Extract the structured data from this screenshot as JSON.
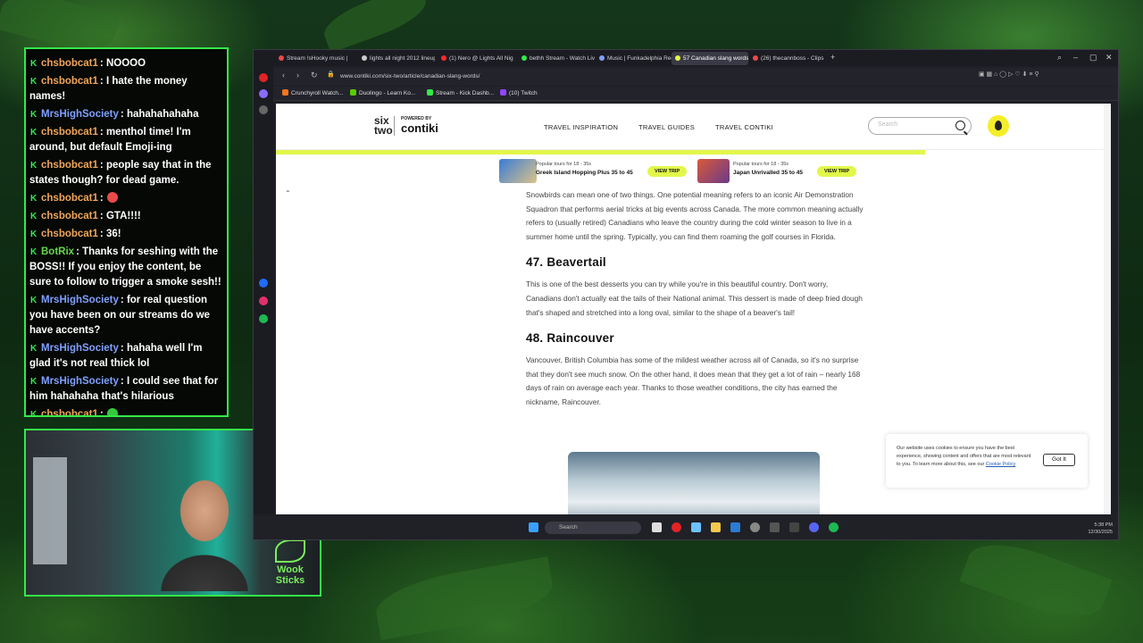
{
  "chat": {
    "messages": [
      {
        "user": "chsbobcat1",
        "text": ": NOOOO",
        "color": "#f0a55a"
      },
      {
        "user": "chsbobcat1",
        "text": ": I hate the money names!",
        "color": "#f0a55a"
      },
      {
        "user": "MrsHighSociety",
        "text": ": hahahahahaha",
        "color": "#7fa0ff"
      },
      {
        "user": "chsbobcat1",
        "text": ": menthol time! I'm around, but default Emoji-ing",
        "color": "#f0a55a"
      },
      {
        "user": "chsbobcat1",
        "text": ": people say that in the states though? for dead game.",
        "color": "#f0a55a"
      },
      {
        "user": "chsbobcat1",
        "text": ":",
        "color": "#f0a55a",
        "emoji": "#e94a4a"
      },
      {
        "user": "chsbobcat1",
        "text": ": GTA!!!!",
        "color": "#f0a55a"
      },
      {
        "user": "chsbobcat1",
        "text": ": 36!",
        "color": "#f0a55a"
      },
      {
        "user": "BotRix",
        "text": ": Thanks for seshing with the BOSS!! If you enjoy the content, be sure to follow to trigger a smoke sesh!!",
        "color": "#66d44a"
      },
      {
        "user": "MrsHighSociety",
        "text": ": for real question you have been on our streams do we have accents?",
        "color": "#7fa0ff"
      },
      {
        "user": "MrsHighSociety",
        "text": ": hahaha well I'm glad it's not real thick lol",
        "color": "#7fa0ff"
      },
      {
        "user": "MrsHighSociety",
        "text": ": I could see that for him hahahaha that's hilarious",
        "color": "#7fa0ff"
      },
      {
        "user": "chsbobcat1",
        "text": ":",
        "color": "#f0a55a",
        "emoji": "#34c83c"
      }
    ]
  },
  "webcam": {
    "logo_line1": "Wook",
    "logo_line2": "Sticks"
  },
  "browser": {
    "tabs": [
      {
        "label": "Stream !sHooky music |",
        "color": "#e94a4a"
      },
      {
        "label": "lights all night 2012 lineup",
        "color": "#cccccc"
      },
      {
        "label": "(1) Nero @ Lights All Nig",
        "color": "#ff2a2a"
      },
      {
        "label": "bethh Stream - Watch Liv",
        "color": "#34e94a"
      },
      {
        "label": "Music | Funkadelphia Rec",
        "color": "#7fa0ff"
      },
      {
        "label": "57 Canadian slang words",
        "color": "#e2f74a"
      },
      {
        "label": "(26) thecannboss - Clips",
        "color": "#e94a4a"
      }
    ],
    "active_tab": 5,
    "url": "www.contiki.com/six-two/article/canadian-slang-words/",
    "bookmarks": [
      {
        "label": "Crunchyroll Watch...",
        "color": "#f47521"
      },
      {
        "label": "Duolingo - Learn Ko...",
        "color": "#58cc02"
      },
      {
        "label": "Stream - Kick Dashb...",
        "color": "#34e94a"
      },
      {
        "label": "(10) Twitch",
        "color": "#9146ff"
      }
    ]
  },
  "site": {
    "logo_top": "six",
    "logo_bottom": "two",
    "powered": "POWERED BY",
    "brand": "contiki",
    "menu": [
      "TRAVEL INSPIRATION",
      "TRAVEL GUIDES",
      "TRAVEL CONTIKI"
    ],
    "search_placeholder": "Search",
    "promos": [
      {
        "kicker": "Popular tours for 18 - 35s",
        "title": "Greek Island Hopping Plus 35 to 45",
        "button": "VIEW TRIP"
      },
      {
        "kicker": "Popular tours for 18 - 35s",
        "title": "Japan Unrivalled 35 to 45",
        "button": "VIEW TRIP"
      }
    ]
  },
  "article": {
    "intro": "Snowbirds can mean one of two things. One potential meaning refers to an iconic Air Demonstration Squadron that performs aerial tricks at big events across Canada. The more common meaning actually refers to (usually retired) Canadians who leave the country during the cold winter season to live in a summer home until the spring. Typically, you can find them roaming the golf courses in Florida.",
    "h47": "47. Beavertail",
    "p47": "This is one of the best desserts you can try while you're in this beautiful country. Don't worry, Canadians don't actually eat the tails of their National animal. This dessert is made of deep fried dough that's shaped and stretched into a long oval, similar to the shape of a beaver's tail!",
    "h48": "48. Raincouver",
    "p48": "Vancouver, British Columbia has some of the mildest weather across all of Canada, so it's no surprise that they don't see much snow. On the other hand, it does mean that they get a lot of rain – nearly 168 days of rain on average each year. Thanks to those weather conditions, the city has earned the nickname, Raincouver."
  },
  "cookie": {
    "text": "Our website uses cookies to ensure you have the best experience, showing content and offers that are most relevant to you. To learn more about this, see our",
    "link": "Cookie Policy",
    "button": "Got It"
  },
  "taskbar": {
    "search": "Search",
    "time": "5:38 PM",
    "date": "12/30/2025"
  }
}
